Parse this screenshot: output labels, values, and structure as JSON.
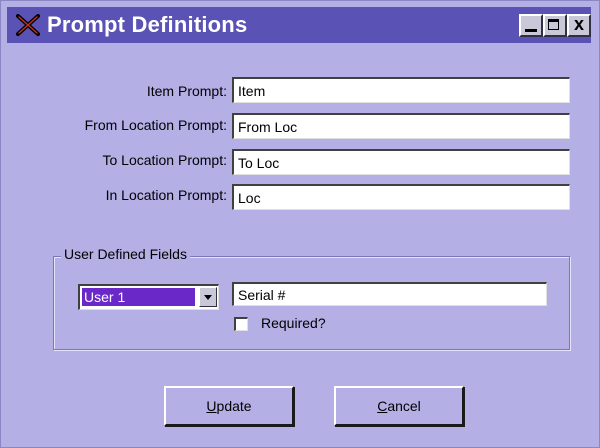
{
  "window": {
    "title": "Prompt Definitions",
    "titlebar_color": "#5a52b4",
    "background_color": "#b4b0e6"
  },
  "title_buttons": {
    "close_glyph": "x"
  },
  "prompts": [
    {
      "label": "Item Prompt:",
      "value": "Item"
    },
    {
      "label": "From Location Prompt:",
      "value": "From Loc"
    },
    {
      "label": "To Location Prompt:",
      "value": "To Loc"
    },
    {
      "label": "In Location Prompt:",
      "value": "Loc"
    }
  ],
  "user_defined": {
    "group_label": "User Defined Fields",
    "selected_option": "User 1",
    "selection_color": "#6a28c8",
    "field_value": "Serial #",
    "required_label": "Required?",
    "required_checked": false
  },
  "buttons": {
    "update_mnemonic": "U",
    "update_rest": "pdate",
    "cancel_mnemonic": "C",
    "cancel_rest": "ancel"
  }
}
